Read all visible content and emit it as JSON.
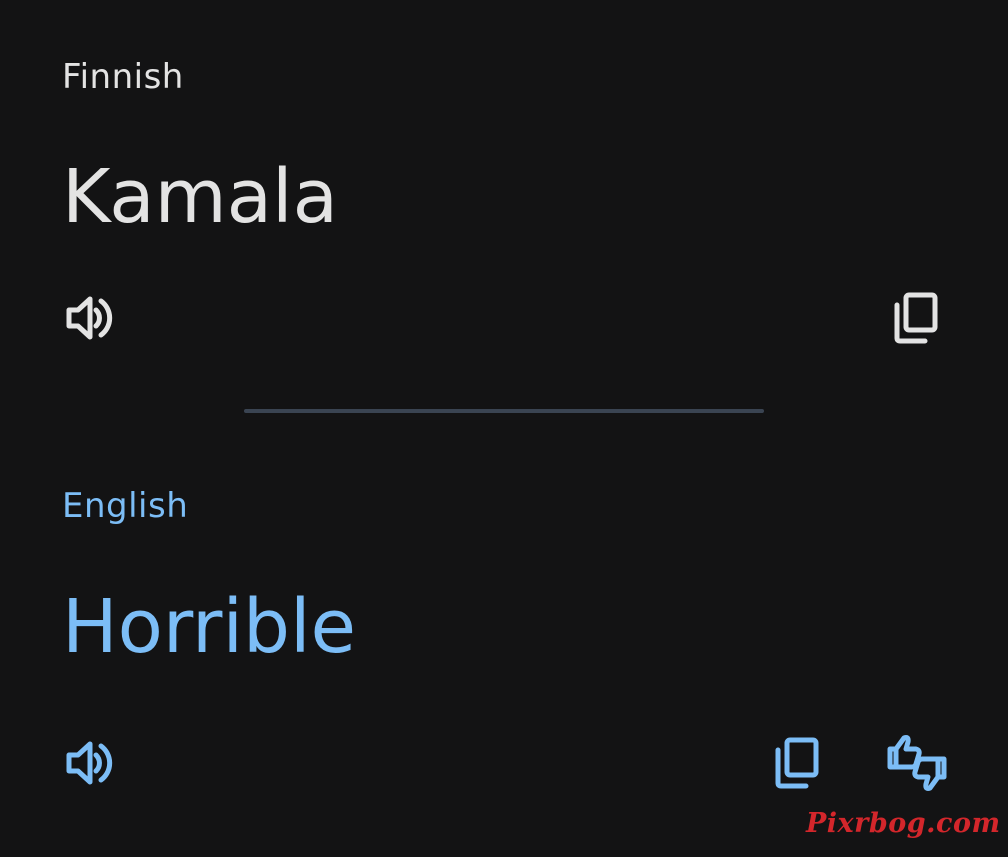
{
  "source": {
    "language": "Finnish",
    "text": "Kamala",
    "icons": {
      "speaker": "volume-up-icon",
      "copy": "copy-icon"
    },
    "color": "#e3e3e3"
  },
  "target": {
    "language": "English",
    "text": "Horrible",
    "icons": {
      "speaker": "volume-up-icon",
      "copy": "copy-icon",
      "rate": "thumbs-up-down-icon"
    },
    "color": "#7cbdf6"
  },
  "background_color": "#131314",
  "divider_color": "#3a4452",
  "watermark": {
    "text": "Pixrbog.com",
    "color": "#d3262b"
  }
}
